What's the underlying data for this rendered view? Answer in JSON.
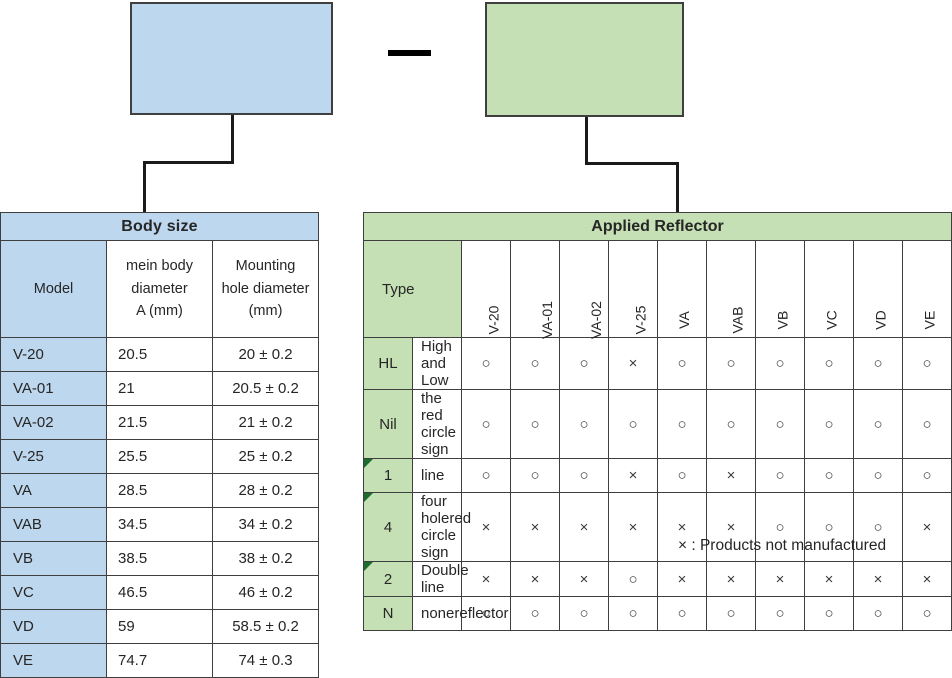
{
  "diagram": {
    "box_body_size": {
      "label": "",
      "color": "#bdd7ee"
    },
    "box_reflector": {
      "label": "",
      "color": "#c5e0b4"
    },
    "separator": "—"
  },
  "body_size_table": {
    "title": "Body size",
    "headers": {
      "model": "Model",
      "main_diameter": "mein body diameter A (mm)",
      "main_diameter_lines": [
        "mein body",
        "diameter",
        "A (mm)"
      ],
      "hole_diameter": "Mounting hole diameter (mm)",
      "hole_diameter_lines": [
        "Mounting",
        "hole diameter",
        "(mm)"
      ]
    },
    "rows": [
      {
        "model": "V-20",
        "diameter": "20.5",
        "hole": "20 ± 0.2"
      },
      {
        "model": "VA-01",
        "diameter": "21",
        "hole": "20.5 ± 0.2"
      },
      {
        "model": "VA-02",
        "diameter": "21.5",
        "hole": "21 ± 0.2"
      },
      {
        "model": "V-25",
        "diameter": "25.5",
        "hole": "25 ± 0.2"
      },
      {
        "model": "VA",
        "diameter": "28.5",
        "hole": "28 ± 0.2"
      },
      {
        "model": "VAB",
        "diameter": "34.5",
        "hole": "34 ± 0.2"
      },
      {
        "model": "VB",
        "diameter": "38.5",
        "hole": "38 ± 0.2"
      },
      {
        "model": "VC",
        "diameter": "46.5",
        "hole": "46 ± 0.2"
      },
      {
        "model": "VD",
        "diameter": "59",
        "hole": "58.5 ± 0.2"
      },
      {
        "model": "VE",
        "diameter": "74.7",
        "hole": "74 ± 0.3"
      }
    ]
  },
  "reflector_table": {
    "title": "Applied Reflector",
    "type_header": "Type",
    "model_columns": [
      "V-20",
      "VA-01",
      "VA-02",
      "V-25",
      "VA",
      "VAB",
      "VB",
      "VC",
      "VD",
      "VE"
    ],
    "rows": [
      {
        "code": "HL",
        "flagged": false,
        "description": "High and Low",
        "marks": [
          "○",
          "○",
          "○",
          "×",
          "○",
          "○",
          "○",
          "○",
          "○",
          "○"
        ]
      },
      {
        "code": "Nil",
        "flagged": false,
        "description": "the red circle sign",
        "marks": [
          "○",
          "○",
          "○",
          "○",
          "○",
          "○",
          "○",
          "○",
          "○",
          "○"
        ]
      },
      {
        "code": "1",
        "flagged": true,
        "description": "line",
        "marks": [
          "○",
          "○",
          "○",
          "×",
          "○",
          "×",
          "○",
          "○",
          "○",
          "○"
        ]
      },
      {
        "code": "4",
        "flagged": true,
        "description": "four holered circle sign",
        "marks": [
          "×",
          "×",
          "×",
          "×",
          "×",
          "×",
          "○",
          "○",
          "○",
          "×"
        ]
      },
      {
        "code": "2",
        "flagged": true,
        "description": "Double line",
        "marks": [
          "×",
          "×",
          "×",
          "○",
          "×",
          "×",
          "×",
          "×",
          "×",
          "×"
        ]
      },
      {
        "code": "N",
        "flagged": false,
        "description": "nonereflector",
        "marks": [
          "○",
          "○",
          "○",
          "○",
          "○",
          "○",
          "○",
          "○",
          "○",
          "○"
        ]
      }
    ]
  },
  "footnote": "× : Products not manufactured"
}
